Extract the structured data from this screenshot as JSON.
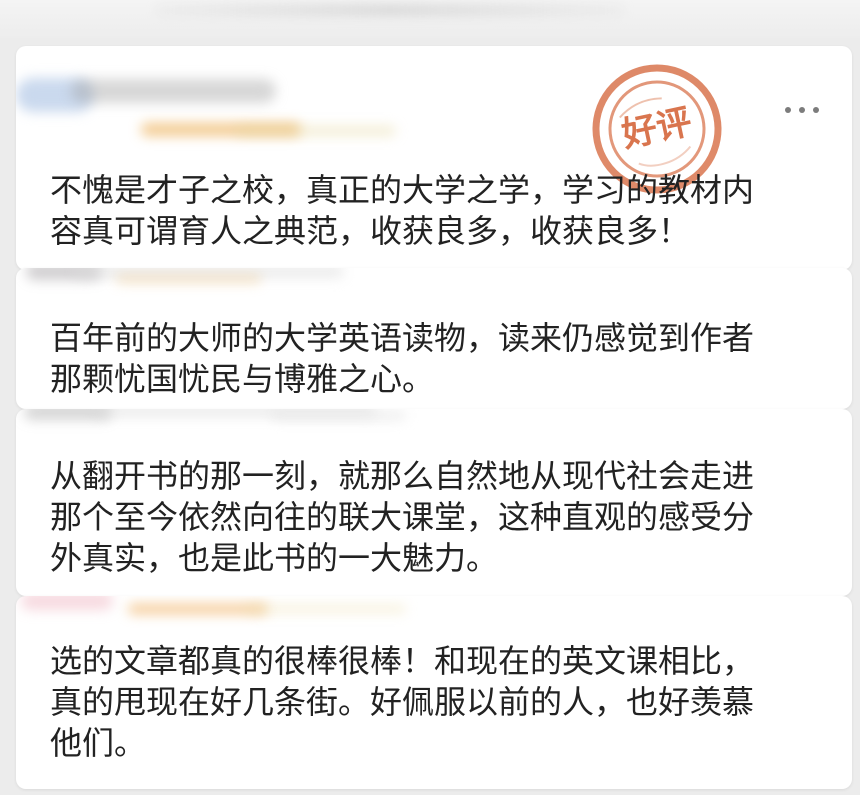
{
  "comments": [
    {
      "text": "不愧是才子之校，真正的大学之学，学习的教材内\n容真可谓育人之典范，收获良多，收获良多！"
    },
    {
      "text": "百年前的大师的大学英语读物，读来仍感觉到作者\n那颗忧国忧民与博雅之心。"
    },
    {
      "text": "从翻开书的那一刻，就那么自然地从现代社会走进\n那个至今依然向往的联大课堂，这种直观的感受分\n外真实，也是此书的一大魅力。"
    },
    {
      "text": "选的文章都真的很棒很棒！和现在的英文课相比，\n真的甩现在好几条街。好佩服以前的人，也好羡慕\n他们。"
    }
  ],
  "stamp": {
    "label": "好评",
    "color": "#d66a3f"
  },
  "icons": {
    "more": "more-icon",
    "stamp": "good-review-stamp"
  },
  "colors": {
    "background": "#ececec",
    "card": "#ffffff",
    "text": "#222222",
    "accent": "#d66a3f",
    "muted": "#7c7c7c"
  }
}
